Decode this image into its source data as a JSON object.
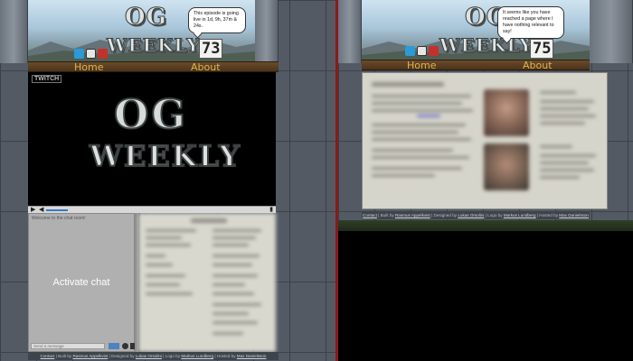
{
  "left": {
    "speech": "This episode is going live in 1d, 9h, 37m & 24s.",
    "logo_top": "OG",
    "logo_bottom": "WEEKLY",
    "episode_number": "73",
    "nav": [
      "Home",
      "About"
    ],
    "video_badge": "TWITCH",
    "video_logo_top": "OG",
    "video_logo_bottom": "WEEKLY",
    "chat_welcome": "Welcome to the chat room!",
    "chat_activate": "Activate chat",
    "chat_placeholder": "Send a message",
    "footer": {
      "contact": "Contact",
      "built_prefix": " | Built by ",
      "built_by": "Rasmus Appelkvist",
      "designed_prefix": " | Designed by ",
      "designed_by": "Lukas Orsolini",
      "logo_prefix": " | Logo by ",
      "logo_by": "Markus Lundberg",
      "hosted_prefix": " | Hosted by ",
      "hosted_by": "Max Danielsson"
    }
  },
  "right": {
    "speech": "It seems like you have reached a page where I have nothing relevant to say!",
    "logo_top": "OG",
    "logo_bottom": "WEEKLY",
    "episode_number": "75",
    "nav": [
      "Home",
      "About"
    ],
    "footer": {
      "contact": "Contact",
      "built_prefix": " | Built by ",
      "built_by": "Rasmus Appelkvist",
      "designed_prefix": " | Designed by ",
      "designed_by": "Lukas Orsolini",
      "logo_prefix": " | Logo by ",
      "logo_by": "Markus Lundberg",
      "hosted_prefix": " | Hosted by ",
      "hosted_by": "Max Danielsson"
    }
  },
  "colors": {
    "nav_text": "#e3b34a",
    "divider": "#8a1a1a",
    "chat_send": "#4d82c4"
  }
}
